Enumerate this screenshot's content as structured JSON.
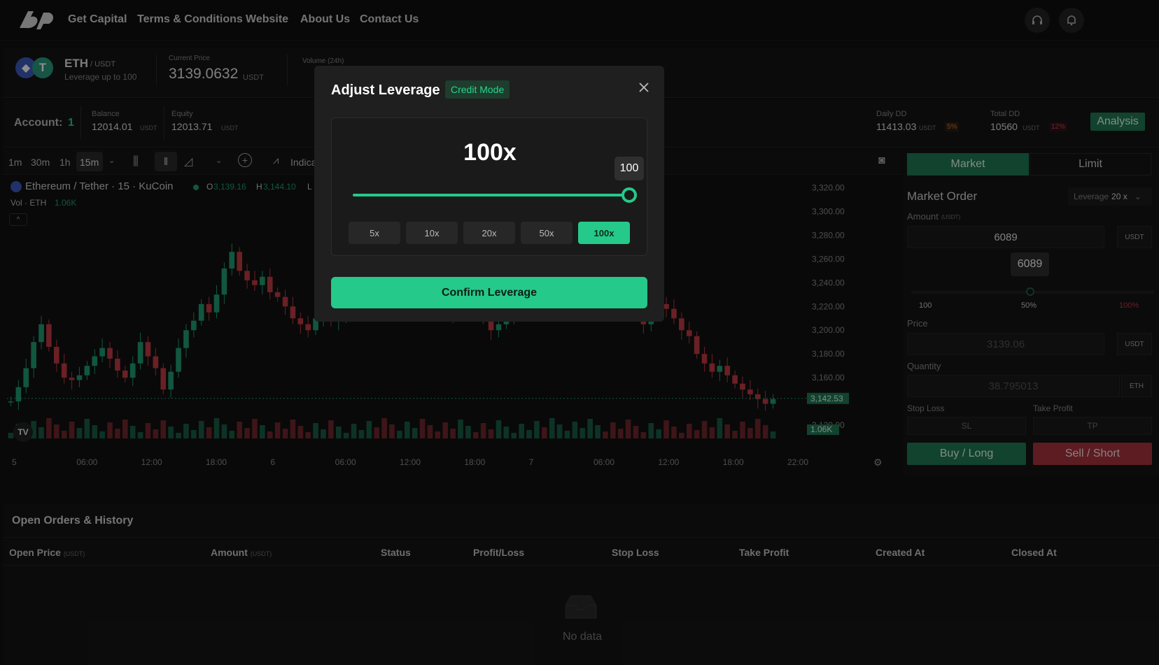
{
  "nav": {
    "links": [
      "Get Capital",
      "Terms & Conditions",
      "Website",
      "About Us",
      "Contact Us"
    ]
  },
  "ticker": {
    "symbol": "ETH",
    "quote": "/ USDT",
    "leverage_note": "Leverage up to 100",
    "current_price_label": "Current Price",
    "current_price": "3139.0632",
    "current_price_unit": "USDT",
    "volume_label": "Volume (24h)"
  },
  "account": {
    "label": "Account:",
    "number": "1",
    "balance_label": "Balance",
    "balance": "12014.01",
    "equity_label": "Equity",
    "equity": "12013.71",
    "unit": "USDT",
    "daily_dd_label": "Daily DD",
    "daily_dd": "11413.03",
    "daily_dd_pct": "5%",
    "total_dd_label": "Total DD",
    "total_dd": "10560",
    "total_dd_pct": "12%",
    "analysis_button": "Analysis"
  },
  "chart_toolbar": {
    "timeframes": [
      "1m",
      "30m",
      "1h",
      "15m"
    ],
    "indicators_label": "Indica"
  },
  "chart_legend": {
    "title": "Ethereum / Tether · 15 · KuCoin",
    "o_label": "O",
    "o_value": "3,139.16",
    "h_label": "H",
    "h_value": "3,144.10",
    "l_label": "L",
    "vol_label": "Vol · ETH",
    "vol_value": "1.06K"
  },
  "chart_data": {
    "type": "candlestick",
    "title": "Ethereum / Tether · 15 · KuCoin",
    "y_ticks": [
      "3,320.00",
      "3,300.00",
      "3,280.00",
      "3,260.00",
      "3,240.00",
      "3,220.00",
      "3,200.00",
      "3,180.00",
      "3,160.00",
      "3,120.00"
    ],
    "x_ticks": [
      "5",
      "06:00",
      "12:00",
      "18:00",
      "6",
      "06:00",
      "12:00",
      "18:00",
      "7",
      "06:00",
      "12:00",
      "18:00",
      "22:00"
    ],
    "last_price_label": "3,142.53",
    "last_volume_label": "1.06K",
    "ylim": [
      3110,
      3325
    ],
    "close_series": [
      3140,
      3152,
      3168,
      3190,
      3205,
      3186,
      3172,
      3160,
      3158,
      3162,
      3170,
      3178,
      3185,
      3176,
      3166,
      3160,
      3172,
      3190,
      3178,
      3168,
      3150,
      3165,
      3185,
      3200,
      3208,
      3222,
      3215,
      3230,
      3252,
      3266,
      3250,
      3242,
      3238,
      3245,
      3232,
      3228,
      3220,
      3210,
      3205,
      3200,
      3210,
      3218,
      3208,
      3212,
      3220,
      3222,
      3226,
      3230,
      3226,
      3222,
      3220,
      3225,
      3228,
      3232,
      3230,
      3225,
      3222,
      3218,
      3214,
      3220,
      3226,
      3220,
      3210,
      3200,
      3205,
      3212,
      3218,
      3222,
      3226,
      3230,
      3228,
      3232,
      3236,
      3240,
      3246,
      3250,
      3256,
      3262,
      3258,
      3250,
      3240,
      3228,
      3216,
      3205,
      3214,
      3222,
      3218,
      3210,
      3200,
      3195,
      3180,
      3172,
      3165,
      3170,
      3162,
      3155,
      3150,
      3146,
      3142,
      3138,
      3142
    ]
  },
  "order_panel": {
    "tabs": [
      "Market",
      "Limit"
    ],
    "title": "Market Order",
    "leverage_label": "Leverage",
    "leverage_value": "20 x",
    "amount_label": "Amount",
    "amount_unit_small": "(USDT)",
    "amount_value": "6089",
    "amount_unit": "USDT",
    "slider_tip": "6089",
    "slider_labels": [
      "100",
      "50%",
      "100%"
    ],
    "price_label": "Price",
    "price_value": "3139.06",
    "price_unit": "USDT",
    "quantity_label": "Quantity",
    "quantity_value": "38.795013",
    "quantity_unit": "ETH",
    "stop_loss_label": "Stop Loss",
    "take_profit_label": "Take Profit",
    "sl_placeholder": "SL",
    "tp_placeholder": "TP",
    "buy_button": "Buy / Long",
    "sell_button": "Sell / Short"
  },
  "history": {
    "title": "Open Orders & History",
    "columns": [
      {
        "label": "Open Price",
        "unit": "(USDT)"
      },
      {
        "label": "Amount",
        "unit": "(USDT)"
      },
      {
        "label": "Status",
        "unit": ""
      },
      {
        "label": "Profit/Loss",
        "unit": ""
      },
      {
        "label": "Stop Loss",
        "unit": ""
      },
      {
        "label": "Take Profit",
        "unit": ""
      },
      {
        "label": "Created At",
        "unit": ""
      },
      {
        "label": "Closed At",
        "unit": ""
      }
    ],
    "empty_text": "No data"
  },
  "modal": {
    "title": "Adjust Leverage",
    "badge": "Credit Mode",
    "leverage_display": "100x",
    "slider_tip": "100",
    "slider_fraction": 1.0,
    "presets": [
      "5x",
      "10x",
      "20x",
      "50x",
      "100x"
    ],
    "active_preset": "100x",
    "confirm_button": "Confirm Leverage"
  },
  "colors": {
    "accent": "#25c98a",
    "up": "#1f9f73",
    "down": "#c23b44",
    "background": "#121212"
  }
}
